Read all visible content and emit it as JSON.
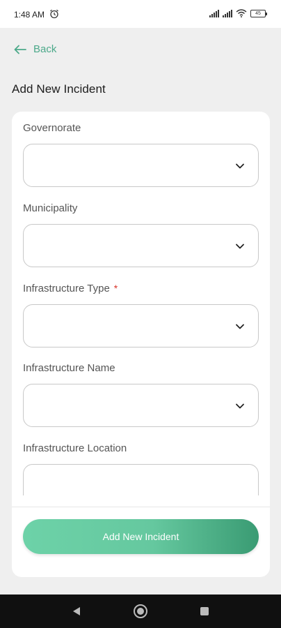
{
  "status_bar": {
    "time": "1:48 AM",
    "battery": "45",
    "icons": [
      "alarm-icon",
      "signal-icon",
      "signal-icon",
      "wifi-icon",
      "battery-icon"
    ]
  },
  "header": {
    "back_label": "Back",
    "title": "Add New Incident"
  },
  "form": {
    "fields": [
      {
        "label": "Governorate",
        "type": "select",
        "value": "",
        "required": false
      },
      {
        "label": "Municipality",
        "type": "select",
        "value": "",
        "required": false
      },
      {
        "label": "Infrastructure Type",
        "type": "select",
        "value": "",
        "required": true,
        "required_marker": "*"
      },
      {
        "label": "Infrastructure Name",
        "type": "select",
        "value": "",
        "required": false
      },
      {
        "label": "Infrastructure Location",
        "type": "text",
        "value": "",
        "required": false
      }
    ],
    "submit_label": "Add New Incident"
  },
  "colors": {
    "accent": "#4ca98a",
    "button_gradient_start": "#6dd2a8",
    "button_gradient_end": "#3a9b73",
    "required": "#d9342b"
  },
  "nav_bar": {
    "icons": [
      "nav-back-icon",
      "nav-home-icon",
      "nav-recent-icon"
    ]
  }
}
